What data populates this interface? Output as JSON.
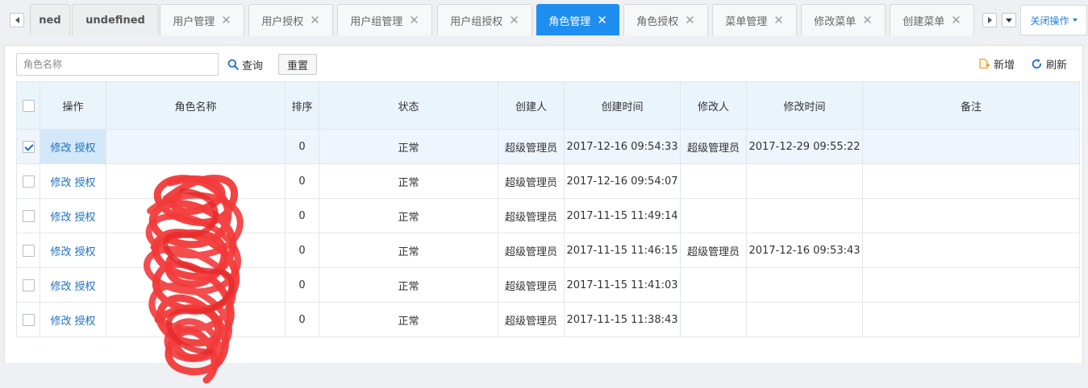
{
  "tabs": [
    {
      "label": "ned",
      "style": "bold",
      "closable": false
    },
    {
      "label": "undefined",
      "style": "bold",
      "closable": false
    },
    {
      "label": "用户管理",
      "closable": true
    },
    {
      "label": "用户授权",
      "closable": true
    },
    {
      "label": "用户组管理",
      "closable": true
    },
    {
      "label": "用户组授权",
      "closable": true
    },
    {
      "label": "角色管理",
      "closable": true,
      "active": true
    },
    {
      "label": "角色授权",
      "closable": true
    },
    {
      "label": "菜单管理",
      "closable": true
    },
    {
      "label": "修改菜单",
      "closable": true
    },
    {
      "label": "创建菜单",
      "closable": true
    }
  ],
  "tab_close_glyph": "✕",
  "close_ops_label": "关闭操作",
  "search": {
    "placeholder": "角色名称",
    "value": ""
  },
  "toolbar": {
    "query_label": "查询",
    "reset_label": "重置",
    "add_label": "新增",
    "refresh_label": "刷新"
  },
  "columns": [
    "操作",
    "角色名称",
    "排序",
    "状态",
    "创建人",
    "创建时间",
    "修改人",
    "修改时间",
    "备注"
  ],
  "row_actions": {
    "edit": "修改",
    "grant": "授权"
  },
  "rows": [
    {
      "checked": true,
      "name": "",
      "sort": "0",
      "status": "正常",
      "creator": "超级管理员",
      "created": "2017-12-16 09:54:33",
      "modifier": "超级管理员",
      "modified": "2017-12-29 09:55:22",
      "remark": ""
    },
    {
      "checked": false,
      "name": "",
      "sort": "0",
      "status": "正常",
      "creator": "超级管理员",
      "created": "2017-12-16 09:54:07",
      "modifier": "",
      "modified": "",
      "remark": ""
    },
    {
      "checked": false,
      "name": "",
      "sort": "0",
      "status": "正常",
      "creator": "超级管理员",
      "created": "2017-11-15 11:49:14",
      "modifier": "",
      "modified": "",
      "remark": ""
    },
    {
      "checked": false,
      "name": "",
      "sort": "0",
      "status": "正常",
      "creator": "超级管理员",
      "created": "2017-11-15 11:46:15",
      "modifier": "超级管理员",
      "modified": "2017-12-16 09:53:43",
      "remark": ""
    },
    {
      "checked": false,
      "name": "",
      "sort": "0",
      "status": "正常",
      "creator": "超级管理员",
      "created": "2017-11-15 11:41:03",
      "modifier": "",
      "modified": "",
      "remark": ""
    },
    {
      "checked": false,
      "name": "",
      "sort": "0",
      "status": "正常",
      "creator": "超级管理员",
      "created": "2017-11-15 11:38:43",
      "modifier": "",
      "modified": "",
      "remark": ""
    }
  ],
  "colors": {
    "accent": "#1e8ef0",
    "link": "#1e6fbf",
    "header_bg": "#eaf4fb",
    "redaction": "#f23a3a",
    "add_icon": "#f0a020"
  }
}
